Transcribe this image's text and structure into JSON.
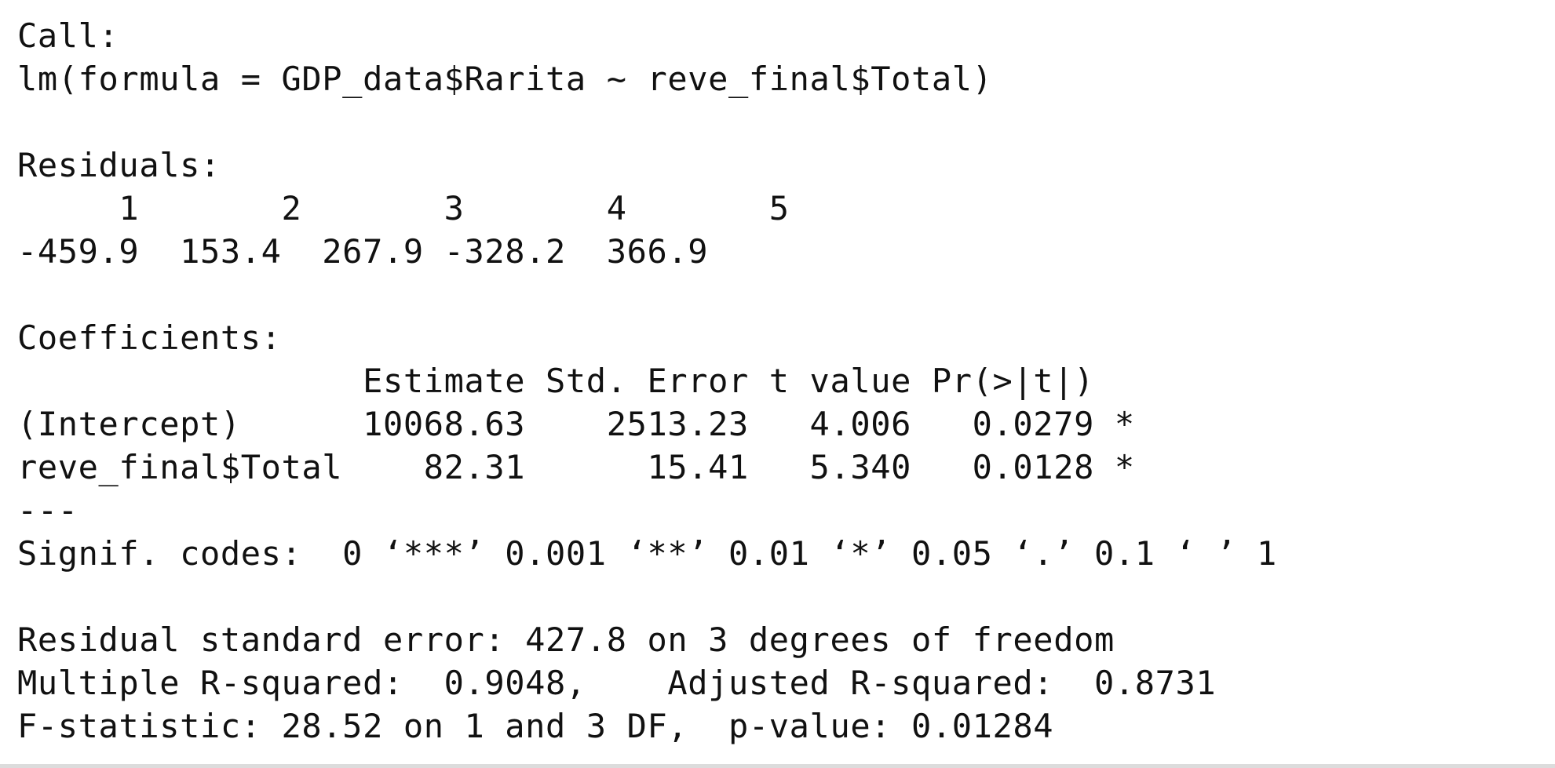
{
  "output": {
    "lines": [
      "Call:",
      "lm(formula = GDP_data$Rarita ~ reve_final$Total)",
      "",
      "Residuals:",
      "     1       2       3       4       5",
      "-459.9  153.4  267.9 -328.2  366.9",
      "",
      "Coefficients:",
      "                 Estimate Std. Error t value Pr(>|t|)",
      "(Intercept)      10068.63    2513.23   4.006   0.0279 *",
      "reve_final$Total    82.31      15.41   5.340   0.0128 *",
      "---",
      "Signif. codes:  0 ‘***’ 0.001 ‘**’ 0.01 ‘*’ 0.05 ‘.’ 0.1 ‘ ’ 1",
      "",
      "Residual standard error: 427.8 on 3 degrees of freedom",
      "Multiple R-squared:  0.9048,\tAdjusted R-squared:  0.8731 ",
      "F-statistic: 28.52 on 1 and 3 DF,  p-value: 0.01284"
    ]
  }
}
